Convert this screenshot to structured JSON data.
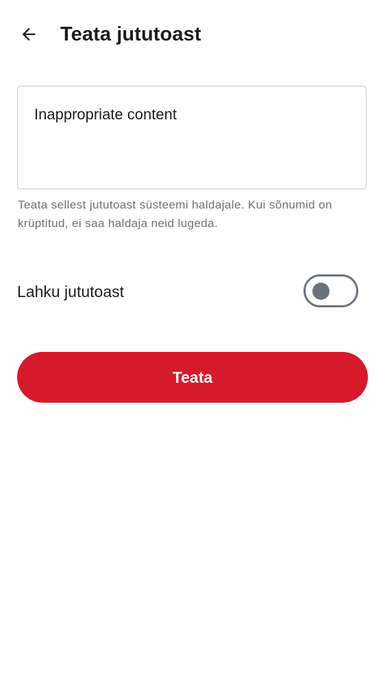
{
  "header": {
    "back_icon": "arrow-left-icon",
    "title": "Teata jututoast"
  },
  "reason_field": {
    "value": "Inappropriate content"
  },
  "helper_text": "Teata sellest jututoast süsteemi haldajale. Kui sõnumid on krüptitud, ei saa haldaja neid lugeda.",
  "leave_room": {
    "label": "Lahku jututoast",
    "enabled": false
  },
  "submit_button": {
    "label": "Teata",
    "color": "#d61a2c"
  }
}
